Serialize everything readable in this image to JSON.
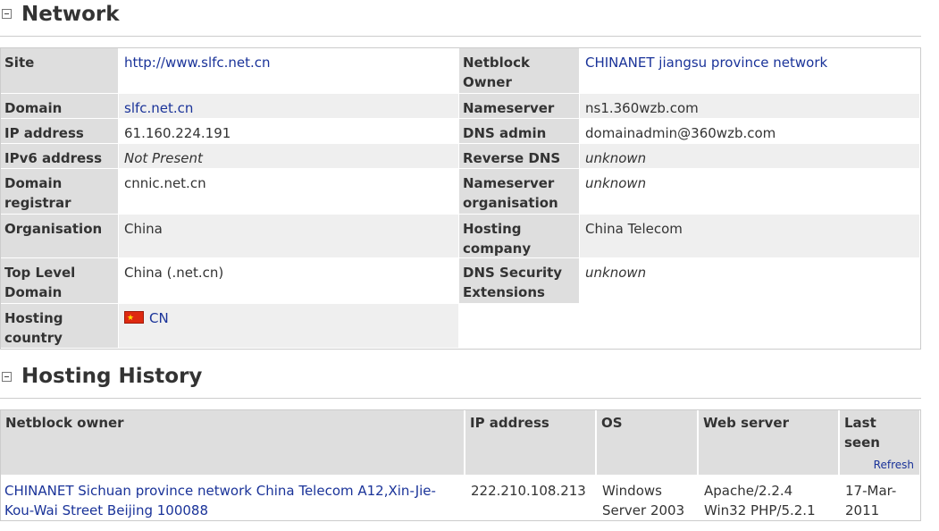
{
  "network": {
    "title": "Network",
    "rows": [
      {
        "l1": "Site",
        "v1": "http://www.slfc.net.cn",
        "l2": "Netblock Owner",
        "v2": "CHINANET jiangsu province network"
      },
      {
        "l1": "Domain",
        "v1": "slfc.net.cn",
        "l2": "Nameserver",
        "v2": "ns1.360wzb.com"
      },
      {
        "l1": "IP address",
        "v1": "61.160.224.191",
        "l2": "DNS admin",
        "v2": "domainadmin@360wzb.com"
      },
      {
        "l1": "IPv6 address",
        "v1": "Not Present",
        "l2": "Reverse DNS",
        "v2": "unknown"
      },
      {
        "l1": "Domain registrar",
        "v1": "cnnic.net.cn",
        "l2": "Nameserver organisation",
        "v2": "unknown"
      },
      {
        "l1": "Organisation",
        "v1": "China",
        "l2": "Hosting company",
        "v2": "China Telecom"
      },
      {
        "l1": "Top Level Domain",
        "v1": "China (.net.cn)",
        "l2": "DNS Security Extensions",
        "v2": "unknown"
      },
      {
        "l1": "Hosting country",
        "v1": "CN"
      }
    ]
  },
  "history": {
    "title": "Hosting History",
    "headers": {
      "owner": "Netblock owner",
      "ip": "IP address",
      "os": "OS",
      "web": "Web server",
      "last": "Last seen",
      "refresh": "Refresh"
    },
    "rows": [
      {
        "owner": "CHINANET Sichuan province network China Telecom A12,Xin-Jie-Kou-Wai Street Beijing 100088",
        "ip": "222.210.108.213",
        "os": "Windows Server 2003",
        "web": "Apache/2.2.4 Win32 PHP/5.2.1",
        "last": "17-Mar-2011"
      }
    ]
  }
}
